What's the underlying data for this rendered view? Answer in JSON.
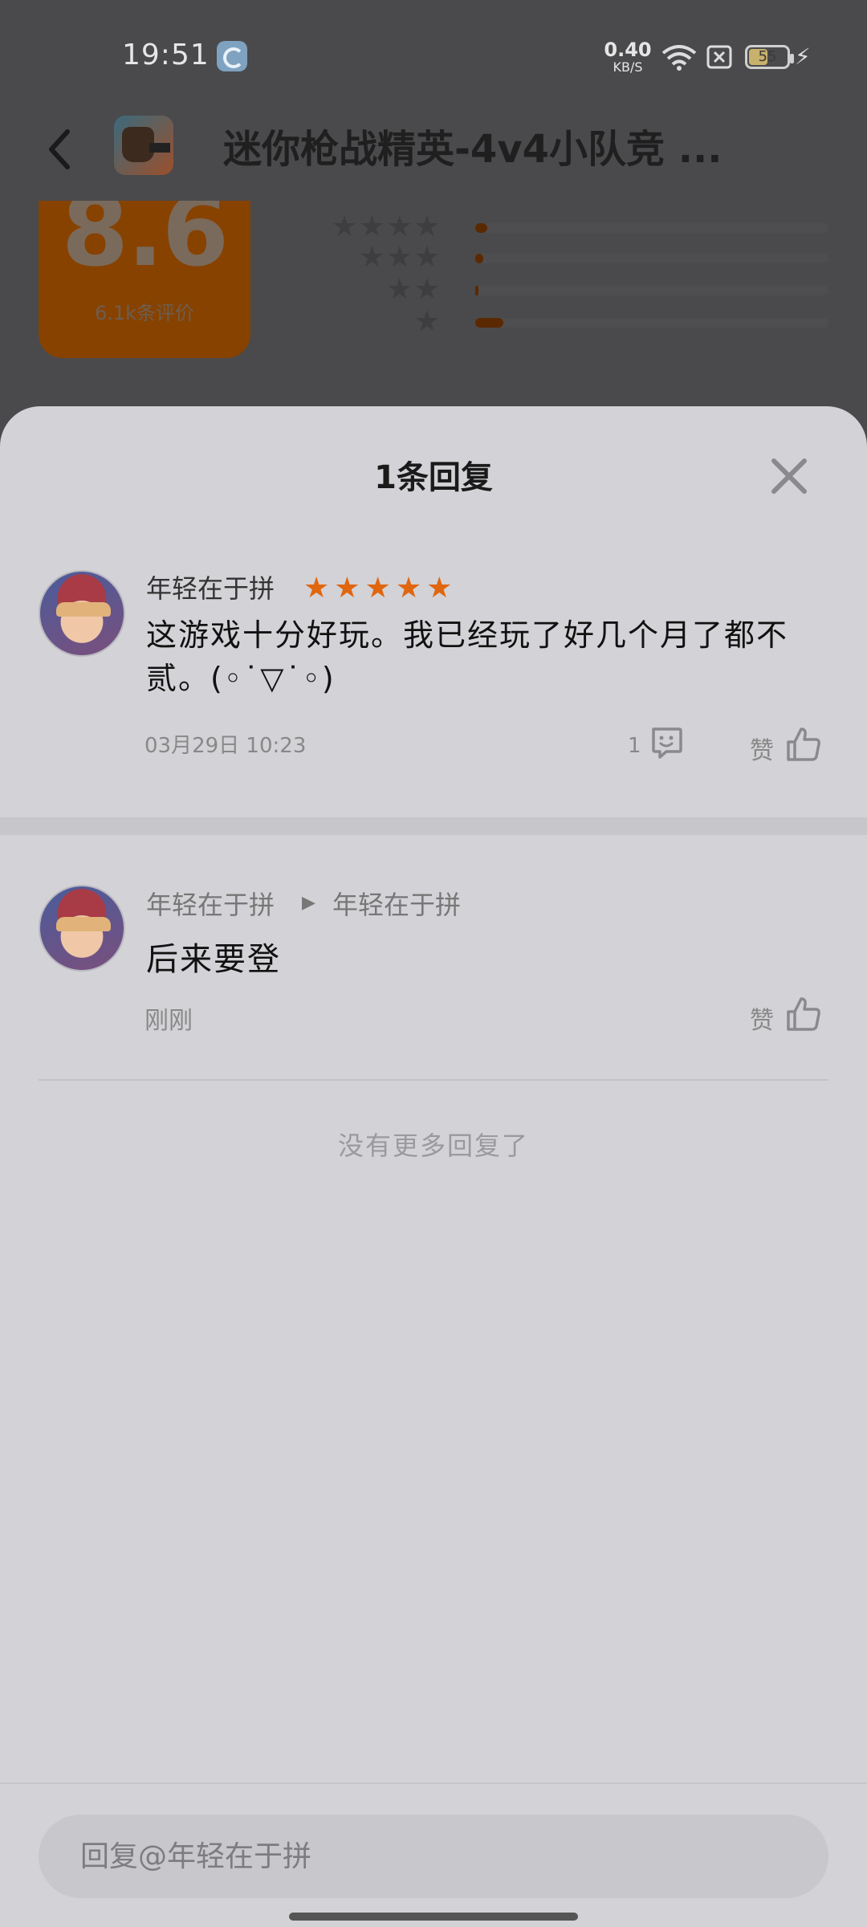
{
  "status_bar": {
    "time": "19:51",
    "net_speed_value": "0.40",
    "net_speed_unit": "KB/S",
    "battery": "55"
  },
  "header": {
    "app_title": "迷你枪战精英-4v4小队竞 ..."
  },
  "rating_summary": {
    "score": "8.6",
    "count_label": "6.1k条评价",
    "distribution": [
      {
        "stars": "★★★★",
        "fraction": 0.035
      },
      {
        "stars": "★★★",
        "fraction": 0.022
      },
      {
        "stars": "★★",
        "fraction": 0.01
      },
      {
        "stars": "★",
        "fraction": 0.08
      }
    ]
  },
  "sheet": {
    "title": "1条回复",
    "comment": {
      "username": "年轻在于拼",
      "rating": "★★★★★",
      "text": "这游戏十分好玩。我已经玩了好几个月了都不贰。(◦˙▽˙◦)",
      "time": "03月29日 10:23",
      "reply_count": "1",
      "like_label": "赞"
    },
    "reply": {
      "from_user": "年轻在于拼",
      "arrow": "▶",
      "to_user": "年轻在于拼",
      "text": "后来要登",
      "time": "刚刚",
      "like_label": "赞"
    },
    "no_more": "没有更多回复了",
    "input_placeholder": "回复@年轻在于拼"
  },
  "colors": {
    "accent_star": "#e06610",
    "sheet_bg": "#d3d2d6"
  }
}
